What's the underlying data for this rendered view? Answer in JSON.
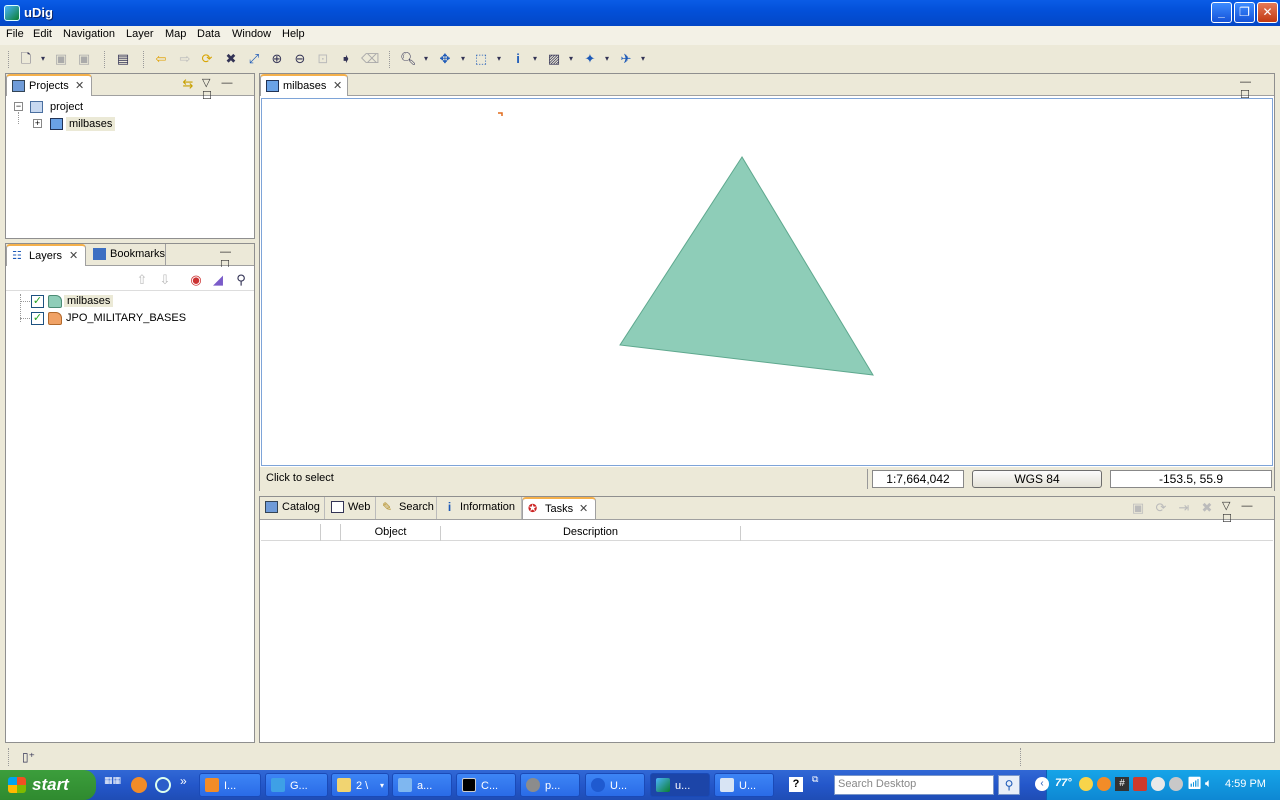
{
  "window": {
    "title": "uDig"
  },
  "menu": [
    "File",
    "Edit",
    "Navigation",
    "Layer",
    "Map",
    "Data",
    "Window",
    "Help"
  ],
  "projects_panel": {
    "tab_label": "Projects",
    "tree": {
      "project": "project",
      "map": "milbases"
    }
  },
  "layers_panel": {
    "tab_label": "Layers",
    "bookmarks_label": "Bookmarks",
    "layers": [
      {
        "name": "milbases",
        "checked": true,
        "color": "#8fcdb8"
      },
      {
        "name": "JPO_MILITARY_BASES",
        "checked": true,
        "color": "#f0a266"
      }
    ]
  },
  "map_editor": {
    "tab_label": "milbases",
    "polygon_color": "#8ecdb8",
    "status_text": "Click to select",
    "scale": "1:7,664,042",
    "crs": "WGS 84",
    "coordinates": "-153.5, 55.9"
  },
  "bottom_panel": {
    "tabs": [
      "Catalog",
      "Web",
      "Search",
      "Information",
      "Tasks"
    ],
    "active_tab": "Tasks",
    "columns": [
      "",
      "Object",
      "Description"
    ]
  },
  "taskbar": {
    "start_label": "start",
    "buttons": [
      "I...",
      "G...",
      "2 \\",
      "a...",
      "C...",
      "p...",
      "U...",
      "u...",
      "U..."
    ],
    "search_placeholder": "Search Desktop",
    "time": "4:59 PM",
    "temperature": "77°"
  }
}
